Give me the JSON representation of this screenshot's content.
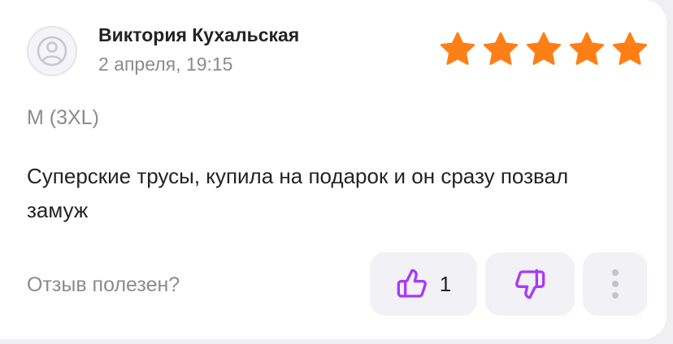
{
  "review": {
    "author": "Виктория Кухальская",
    "date": "2 апреля, 19:15",
    "rating": 5,
    "rating_max": 5,
    "size": "M (3XL)",
    "text": "Суперские трусы, купила на подарок и он сразу позвал замуж"
  },
  "feedback": {
    "question": "Отзыв полезен?",
    "like_count": "1",
    "like_icon": "thumbs-up-icon",
    "dislike_icon": "thumbs-down-icon",
    "more_icon": "more-vertical-icon"
  },
  "colors": {
    "star": "#ff7f17",
    "accent": "#a73afd",
    "muted_text": "#8a8a93",
    "button_bg": "#f2f1f6"
  }
}
